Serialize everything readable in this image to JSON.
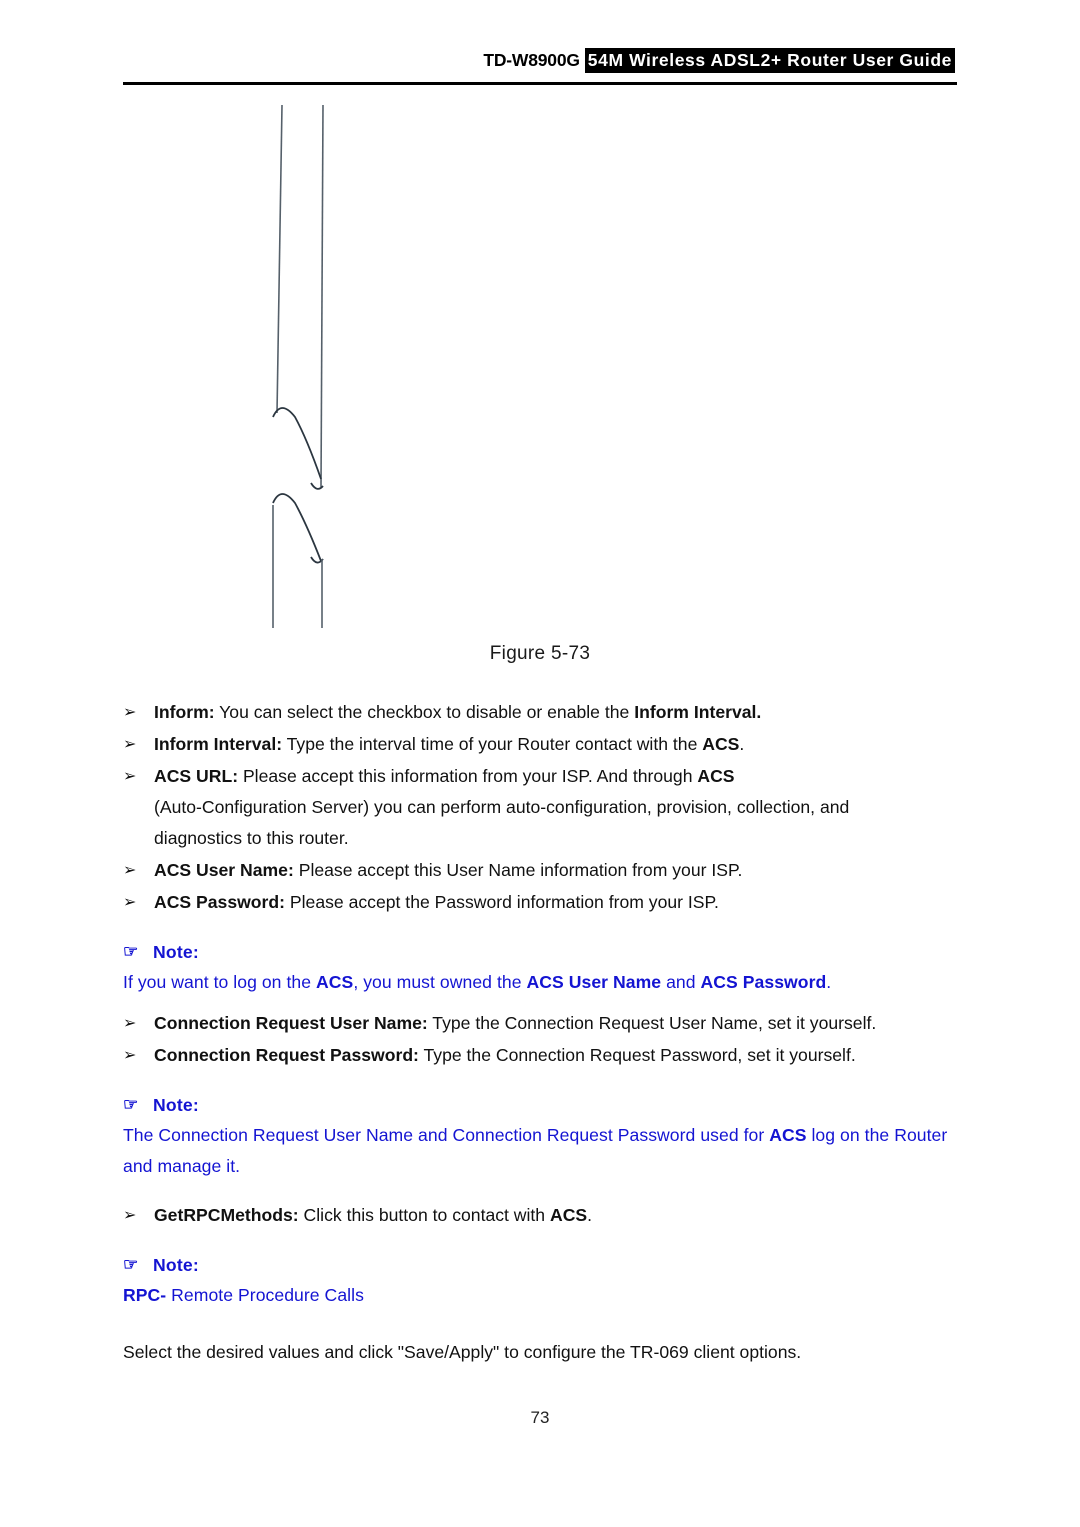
{
  "header": {
    "model": "TD-W8900G",
    "title": "54M  Wireless  ADSL2+  Router  User  Guide",
    "highlight_bg": "#000000",
    "highlight_fg": "#ffffff"
  },
  "figure": {
    "caption": "Figure 5-73",
    "placeholder_note": "broken-image-artifact"
  },
  "colors": {
    "note_blue": "#1414d2",
    "body_black": "#111111"
  },
  "bullets": {
    "glyph": "➢",
    "items": [
      {
        "term": "Inform:",
        "body_pre": " You can select the checkbox to disable or enable the ",
        "body_bold": "Inform Interval.",
        "body_post": ""
      },
      {
        "term": "Inform Interval:",
        "body_pre": " Type the interval time of your Router contact with the ",
        "body_bold": "ACS",
        "body_post": "."
      },
      {
        "term": "ACS  URL:",
        "line1_pre": "  Please  accept  this  information  from  your  ISP.  And  through  ",
        "line1_bold": "ACS",
        "line2": "(Auto-Configuration  Server)  you  can  perform  auto-configuration,  provision,  collection,  and",
        "line3": "diagnostics to this router."
      },
      {
        "term": "ACS User Name:",
        "body_pre": " Please accept this User Name information from your ISP.",
        "body_bold": "",
        "body_post": ""
      },
      {
        "term": "ACS Password:",
        "body_pre": " Please accept the Password information from your ISP.",
        "body_bold": "",
        "body_post": ""
      },
      {
        "term": "Connection Request User Name:",
        "body_pre": " Type the Connection Request User Name, set it yourself.",
        "body_bold": "",
        "body_post": ""
      },
      {
        "term": "Connection Request Password:",
        "body_pre": " Type the Connection Request Password, set it yourself.",
        "body_bold": "",
        "body_post": ""
      },
      {
        "term": "GetRPCMethods:",
        "body_pre": " Click this button to contact with ",
        "body_bold": "ACS",
        "body_post": "."
      }
    ]
  },
  "notes": [
    {
      "hand_glyph": "☞",
      "label": "Note:",
      "text_parts": {
        "p1": "If you want to log on the ",
        "b1": "ACS",
        "p2": ", you must owned the ",
        "b2": "ACS User Name",
        "p3": " and ",
        "b3": "ACS Password",
        "p4": "."
      }
    },
    {
      "hand_glyph": "☞",
      "label": "Note:",
      "text_parts": {
        "p1": "The Connection Request User Name and Connection Request Password used for ",
        "b1": "ACS",
        "p2": " log on the Router and manage it.",
        "b2": "",
        "p3": "",
        "b3": "",
        "p4": ""
      }
    },
    {
      "hand_glyph": "☞",
      "label": "Note:",
      "text_parts": {
        "p1": "",
        "b1": "RPC-",
        "p2": " Remote Procedure Calls",
        "b2": "",
        "p3": "",
        "b3": "",
        "p4": ""
      }
    }
  ],
  "closing_paragraph": "Select the desired values and click \"Save/Apply\" to configure the TR-069 client options.",
  "footer": {
    "page_number": "73"
  }
}
